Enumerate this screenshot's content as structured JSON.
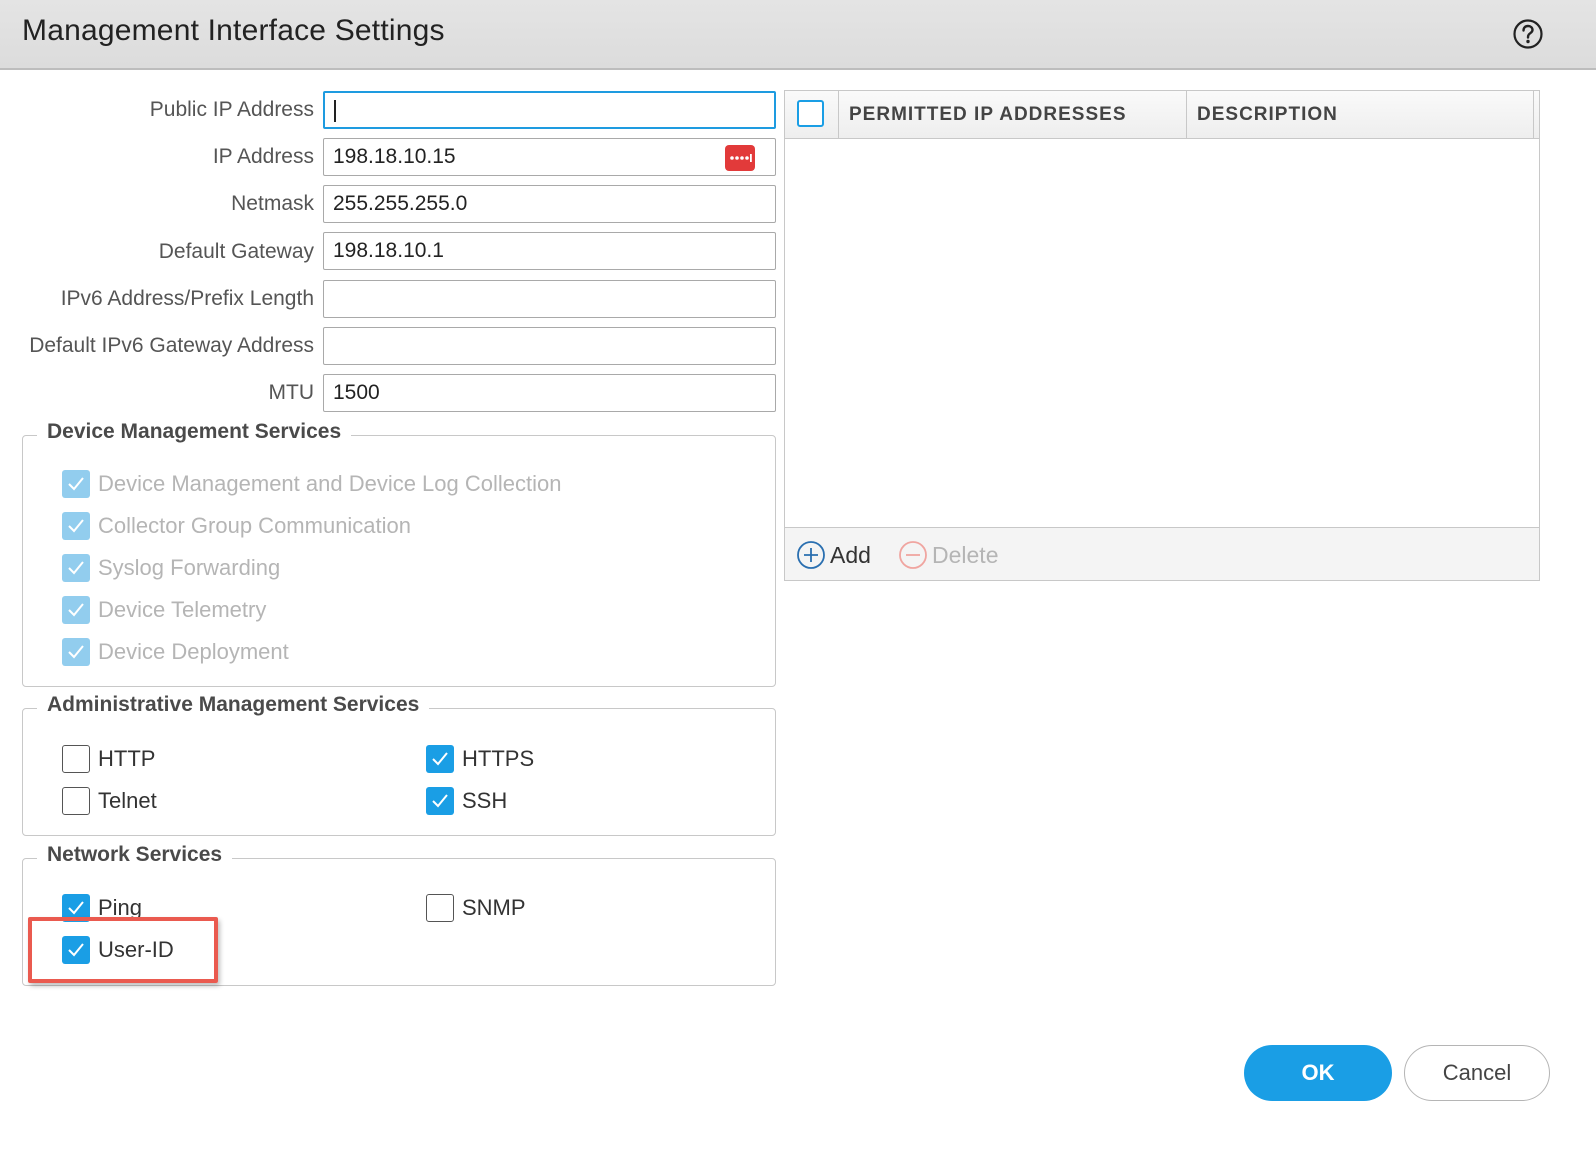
{
  "dialog": {
    "title": "Management Interface Settings",
    "help_icon": "question-circle-icon"
  },
  "fields": [
    {
      "label": "Public IP Address",
      "value": "",
      "focused": true
    },
    {
      "label": "IP Address",
      "value": "198.18.10.15"
    },
    {
      "label": "Netmask",
      "value": "255.255.255.0"
    },
    {
      "label": "Default Gateway",
      "value": "198.18.10.1"
    },
    {
      "label": "IPv6 Address/Prefix Length",
      "value": ""
    },
    {
      "label": "Default IPv6 Gateway Address",
      "value": ""
    },
    {
      "label": "MTU",
      "value": "1500"
    }
  ],
  "device_management": {
    "legend": "Device Management Services",
    "items": [
      {
        "label": "Device Management and Device Log Collection",
        "checked": true,
        "disabled": true
      },
      {
        "label": "Collector Group Communication",
        "checked": true,
        "disabled": true
      },
      {
        "label": "Syslog Forwarding",
        "checked": true,
        "disabled": true
      },
      {
        "label": "Device Telemetry",
        "checked": true,
        "disabled": true
      },
      {
        "label": "Device Deployment",
        "checked": true,
        "disabled": true
      }
    ]
  },
  "admin_management": {
    "legend": "Administrative Management Services",
    "items": [
      {
        "label": "HTTP",
        "checked": false
      },
      {
        "label": "HTTPS",
        "checked": true
      },
      {
        "label": "Telnet",
        "checked": false
      },
      {
        "label": "SSH",
        "checked": true
      }
    ]
  },
  "network_services": {
    "legend": "Network Services",
    "items": [
      {
        "label": "Ping",
        "checked": true
      },
      {
        "label": "SNMP",
        "checked": false
      },
      {
        "label": "User-ID",
        "checked": true,
        "highlighted": true
      }
    ]
  },
  "permitted_table": {
    "columns": [
      "PERMITTED IP ADDRESSES",
      "DESCRIPTION"
    ],
    "rows": [],
    "add_label": "Add",
    "delete_label": "Delete"
  },
  "buttons": {
    "ok": "OK",
    "cancel": "Cancel"
  },
  "colors": {
    "accent": "#1a9ee5",
    "highlight": "#ea5a4f",
    "ip_picker": "#e23a3a"
  }
}
